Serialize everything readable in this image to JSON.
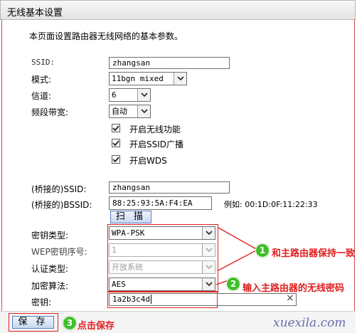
{
  "header": {
    "title": "无线基本设置"
  },
  "intro": "本页面设置路由器无线网络的基本参数。",
  "form": {
    "ssid": {
      "label": "SSID:",
      "value": "zhangsan"
    },
    "mode": {
      "label": "模式:",
      "value": "11bgn mixed"
    },
    "channel": {
      "label": "信道:",
      "value": "6"
    },
    "bandwidth": {
      "label": "频段带宽:",
      "value": "自动"
    },
    "checkboxes": [
      {
        "label": "开启无线功能",
        "checked": true
      },
      {
        "label": "开启SSID广播",
        "checked": true
      },
      {
        "label": "开启WDS",
        "checked": true
      }
    ],
    "bridge_ssid": {
      "label": "(桥接的)SSID:",
      "value": "zhangsan"
    },
    "bridge_bssid": {
      "label": "(桥接的)BSSID:",
      "value": "88:25:93:5A:F4:EA",
      "example": "例如: 00:1D:0F:11:22:33"
    },
    "scan_button": "扫 描",
    "key_type": {
      "label": "密钥类型:",
      "value": "WPA-PSK"
    },
    "wep_index": {
      "label": "WEP密钥序号:",
      "value": "1"
    },
    "auth_type": {
      "label": "认证类型:",
      "value": "开放系统"
    },
    "encryption": {
      "label": "加密算法:",
      "value": "AES"
    },
    "key": {
      "label": "密钥:",
      "value": "1a2b3c4d"
    }
  },
  "save_button": "保 存",
  "annotations": [
    {
      "number": "1",
      "text": "和主路由器保持一致"
    },
    {
      "number": "2",
      "text": "输入主路由器的无线密码"
    },
    {
      "number": "3",
      "text": "点击保存"
    }
  ],
  "watermark": "xuexila.com",
  "colors": {
    "annotation_red": "#e02020",
    "badge_green": "#3fbf2a",
    "panel_border": "#d14b4b"
  }
}
